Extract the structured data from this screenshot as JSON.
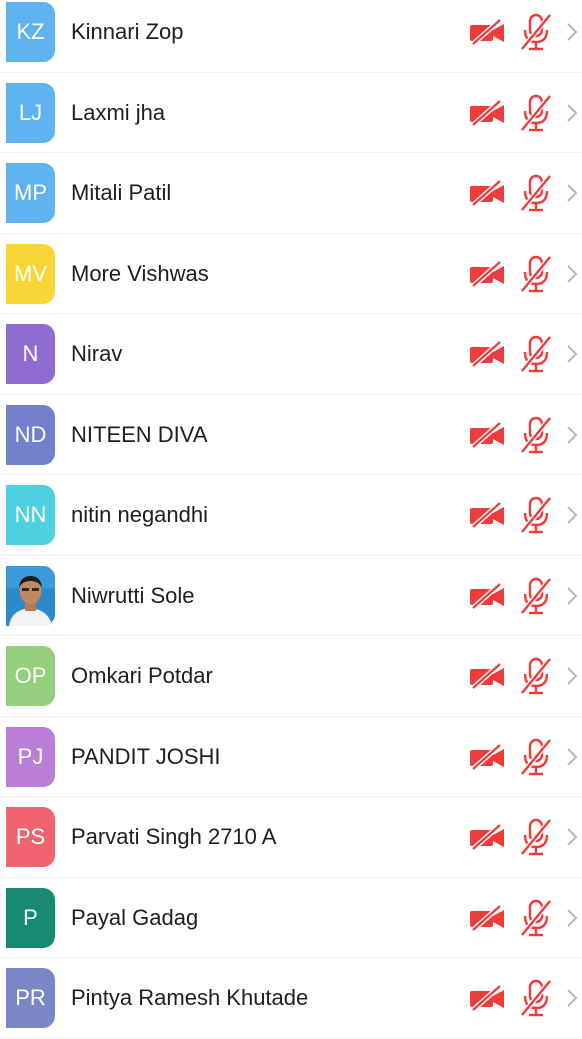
{
  "colors": {
    "status_red": "#ee3b3b",
    "chevron": "#b8b8b8",
    "divider": "#eeeeee"
  },
  "participants": [
    {
      "initials": "KZ",
      "name": "Kinnari Zop",
      "avatar_color": "#5fb2f0",
      "avatar_type": "initials"
    },
    {
      "initials": "LJ",
      "name": "Laxmi jha",
      "avatar_color": "#5fb2f0",
      "avatar_type": "initials"
    },
    {
      "initials": "MP",
      "name": "Mitali Patil",
      "avatar_color": "#5fb2f0",
      "avatar_type": "initials"
    },
    {
      "initials": "MV",
      "name": "More Vishwas",
      "avatar_color": "#f9d535",
      "avatar_type": "initials"
    },
    {
      "initials": "N",
      "name": "Nirav",
      "avatar_color": "#8e6cd1",
      "avatar_type": "initials"
    },
    {
      "initials": "ND",
      "name": "NITEEN DIVA",
      "avatar_color": "#717fcc",
      "avatar_type": "initials"
    },
    {
      "initials": "NN",
      "name": "nitin negandhi",
      "avatar_color": "#4fcfe2",
      "avatar_type": "initials"
    },
    {
      "initials": "",
      "name": "Niwrutti Sole",
      "avatar_color": "#d7e6f2",
      "avatar_type": "photo"
    },
    {
      "initials": "OP",
      "name": "Omkari Potdar",
      "avatar_color": "#93cf7c",
      "avatar_type": "initials"
    },
    {
      "initials": "PJ",
      "name": "PANDIT JOSHI",
      "avatar_color": "#b97ed6",
      "avatar_type": "initials"
    },
    {
      "initials": "PS",
      "name": "Parvati Singh 2710 A",
      "avatar_color": "#f06370",
      "avatar_type": "initials"
    },
    {
      "initials": "P",
      "name": "Payal Gadag",
      "avatar_color": "#178a72",
      "avatar_type": "initials"
    },
    {
      "initials": "PR",
      "name": "Pintya Ramesh Khutade",
      "avatar_color": "#7b86c7",
      "avatar_type": "initials"
    }
  ],
  "row_icons": {
    "video": "video-off-icon",
    "audio": "mic-off-icon",
    "navigate": "chevron-right-icon"
  }
}
